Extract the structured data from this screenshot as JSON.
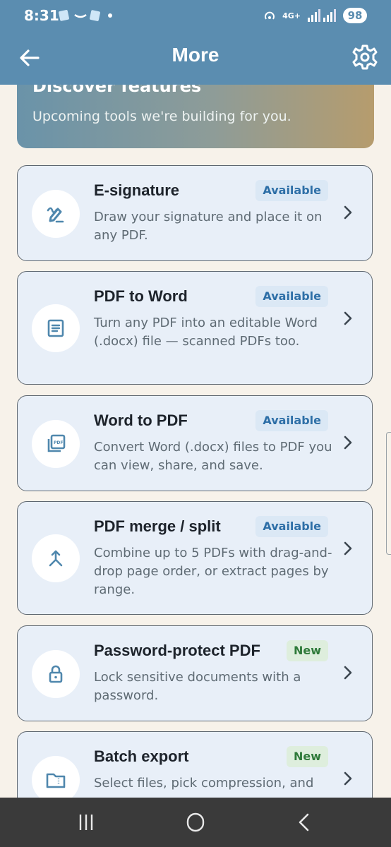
{
  "status_bar": {
    "time": "8:31",
    "network": "4G+",
    "battery": "98"
  },
  "app_bar": {
    "title": "More",
    "back_icon": "arrow-left-icon",
    "settings_icon": "gear-icon"
  },
  "discover": {
    "heading": "Discover features",
    "subheading": "Upcoming tools we're building for you."
  },
  "features": [
    {
      "name": "E-signature",
      "badge": "Available",
      "badge_type": "available",
      "description": "Draw your signature and place it on any PDF.",
      "icon": "pen-signature-icon"
    },
    {
      "name": "PDF to Word",
      "badge": "Available",
      "badge_type": "available",
      "description": "Turn any PDF into an editable Word (.docx) file — scanned PDFs too.",
      "icon": "document-lines-icon"
    },
    {
      "name": "Word to PDF",
      "badge": "Available",
      "badge_type": "available",
      "description": "Convert Word (.docx) files to PDF you can view, share, and save.",
      "icon": "pdf-stack-icon"
    },
    {
      "name": "PDF merge / split",
      "badge": "Available",
      "badge_type": "available",
      "description": "Combine up to 5 PDFs with drag-and-drop page order, or extract pages by range.",
      "icon": "merge-icon"
    },
    {
      "name": "Password-protect PDF",
      "badge": "New",
      "badge_type": "new",
      "description": "Lock sensitive documents with a password.",
      "icon": "lock-icon"
    },
    {
      "name": "Batch export",
      "badge": "New",
      "badge_type": "new",
      "description": "Select files, pick compression, and",
      "icon": "folder-zip-icon"
    }
  ],
  "colors": {
    "app_bar": "#5b8db0",
    "card_bg": "#e8eff8",
    "available_text": "#2e6fa7",
    "new_text": "#2f7a3a",
    "page_bg": "#f7f2ea"
  }
}
